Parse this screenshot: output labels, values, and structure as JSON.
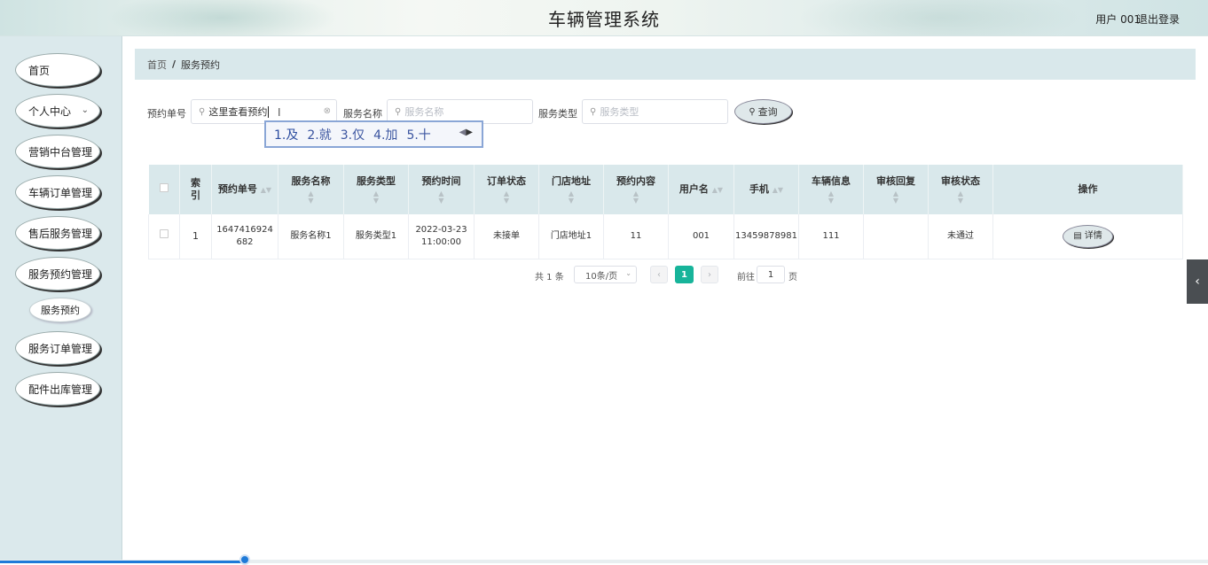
{
  "header": {
    "title": "车辆管理系统",
    "user_label": "用户 001",
    "logout_label": "退出登录"
  },
  "sidebar": {
    "items": [
      {
        "label": "首页"
      },
      {
        "label": "个人中心",
        "has_dropdown": true
      },
      {
        "label": "营销中台管理"
      },
      {
        "label": "车辆订单管理"
      },
      {
        "label": "售后服务管理"
      },
      {
        "label": "服务预约管理"
      },
      {
        "label": "服务预约",
        "sub": true
      },
      {
        "label": "服务订单管理"
      },
      {
        "label": "配件出库管理"
      }
    ]
  },
  "breadcrumb": {
    "home": "首页",
    "separator": "/",
    "current": "服务预约"
  },
  "search": {
    "booking_no_label": "预约单号",
    "booking_no_value": "这里查看预约",
    "service_name_label": "服务名称",
    "service_name_placeholder": "服务名称",
    "service_type_label": "服务类型",
    "service_type_placeholder": "服务类型",
    "search_button": "查询"
  },
  "ime": {
    "candidates": [
      "1.及",
      "2.就",
      "3.仅",
      "4.加",
      "5.十"
    ]
  },
  "table": {
    "headers": [
      "",
      "索引",
      "预约单号",
      "服务名称",
      "服务类型",
      "预约时间",
      "订单状态",
      "门店地址",
      "预约内容",
      "用户名",
      "手机",
      "车辆信息",
      "审核回复",
      "审核状态",
      "操作"
    ],
    "rows": [
      {
        "index": "1",
        "booking_no": "1647416924682",
        "service_name": "服务名称1",
        "service_type": "服务类型1",
        "booking_date": "2022-03-23",
        "booking_time": "11:00:00",
        "order_status": "未接单",
        "store_address": "门店地址1",
        "booking_content": "11",
        "username": "001",
        "phone": "13459878981",
        "vehicle_info": "111",
        "review_reply": "",
        "review_status": "未通过",
        "action": "详情"
      }
    ]
  },
  "pagination": {
    "total_text": "共 1 条",
    "page_size": "10条/页",
    "current_page": "1",
    "goto_label": "前往",
    "goto_value": "1",
    "page_suffix": "页"
  },
  "colors": {
    "accent": "#17b49a",
    "header_bg": "#d9e8eb",
    "sidebar_bg": "#dbe9ec"
  }
}
